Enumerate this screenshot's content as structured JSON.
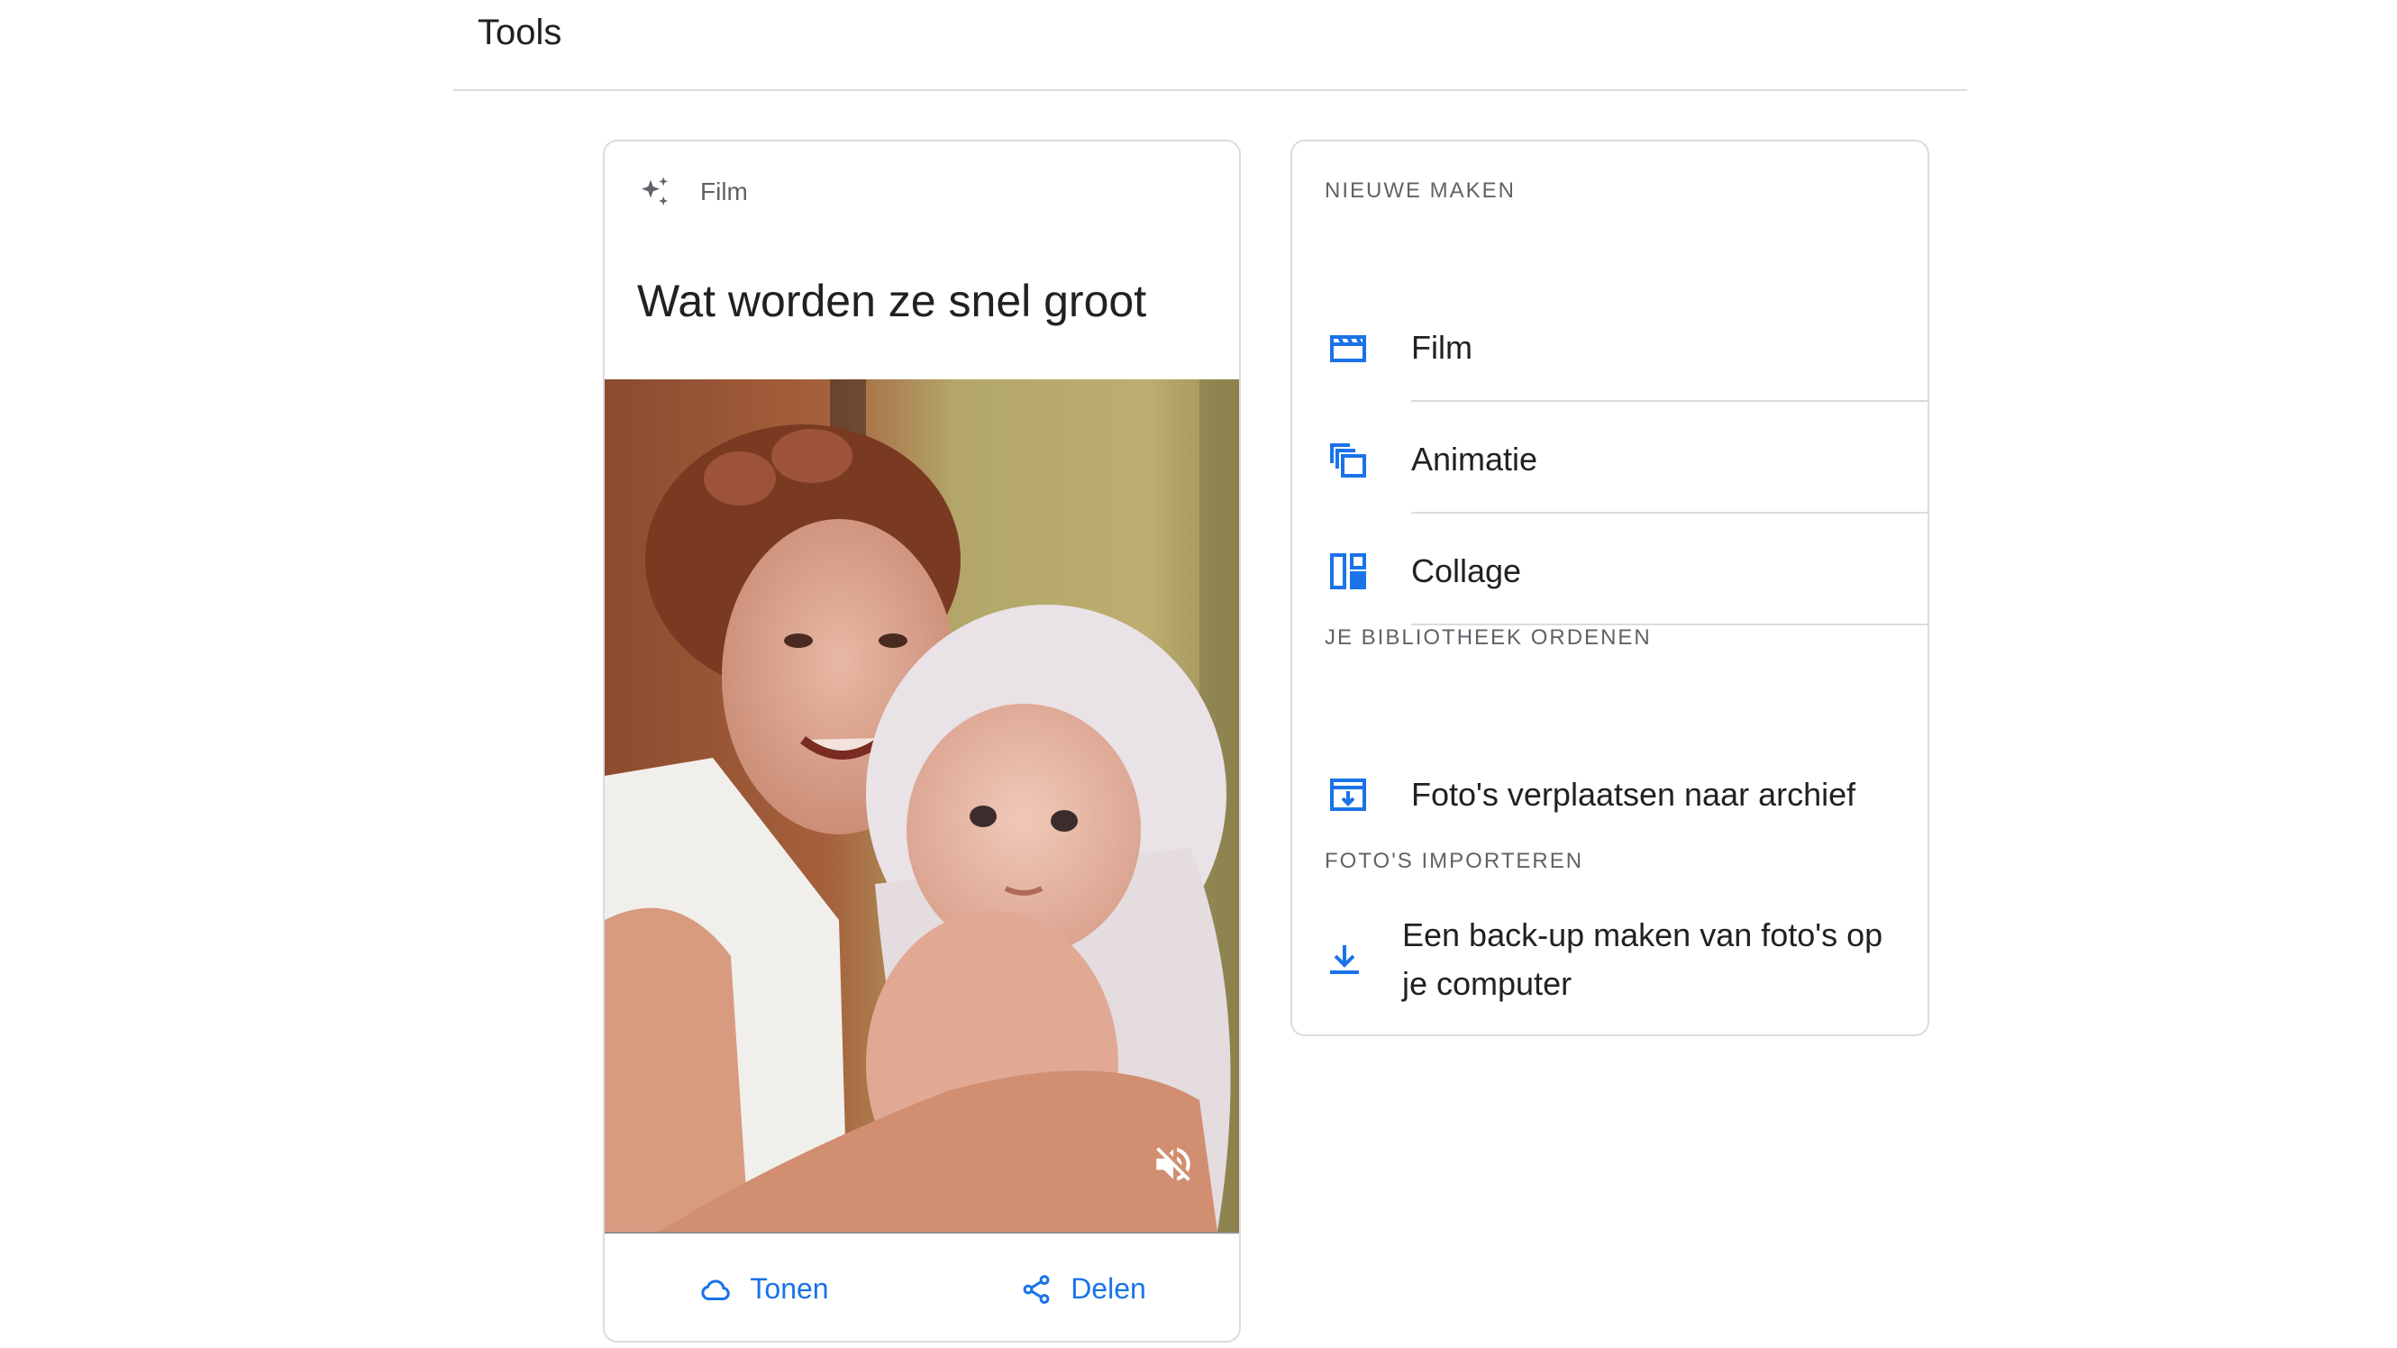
{
  "page": {
    "title": "Tools"
  },
  "movie_card": {
    "type_label": "Film",
    "title": "Wat worden ze snel groot",
    "actions": {
      "show_label": "Tonen",
      "share_label": "Delen"
    }
  },
  "tools": {
    "sections": [
      {
        "heading": "NIEUWE MAKEN",
        "items": [
          {
            "label": "Film",
            "icon": "movie-icon"
          },
          {
            "label": "Animatie",
            "icon": "animation-icon"
          },
          {
            "label": "Collage",
            "icon": "collage-icon"
          }
        ]
      },
      {
        "heading": "JE BIBLIOTHEEK ORDENEN",
        "items": [
          {
            "label": "Foto's verplaatsen naar archief",
            "icon": "archive-icon"
          }
        ]
      },
      {
        "heading": "FOTO'S IMPORTEREN",
        "items": [
          {
            "label": "Een back-up maken van foto's op je computer",
            "icon": "download-icon"
          }
        ]
      }
    ]
  },
  "colors": {
    "accent": "#1a73e8",
    "border": "#dadce0",
    "text": "#202124",
    "muted": "#5f6368"
  }
}
